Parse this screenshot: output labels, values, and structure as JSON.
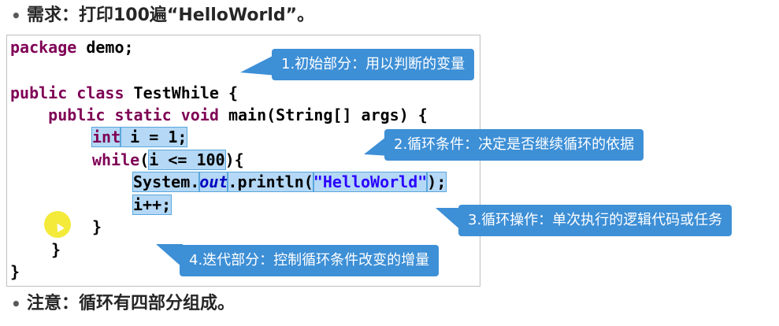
{
  "header": {
    "bullet": "•",
    "requirement_label": "需求：打印100遍“HelloWorld”。"
  },
  "code": {
    "lines": [
      {
        "id": "l1",
        "parts": [
          {
            "t": "package",
            "c": "kw"
          },
          {
            "t": " demo;",
            "c": ""
          }
        ]
      },
      {
        "id": "l2",
        "parts": [
          {
            "t": "public",
            "c": "kw"
          },
          {
            "t": " ",
            "c": ""
          },
          {
            "t": "class",
            "c": "kw"
          },
          {
            "t": " TestWhile {",
            "c": ""
          }
        ]
      },
      {
        "id": "l3",
        "parts": [
          {
            "t": "    public",
            "c": "kw"
          },
          {
            "t": " ",
            "c": ""
          },
          {
            "t": "static",
            "c": "kw"
          },
          {
            "t": " ",
            "c": ""
          },
          {
            "t": "void",
            "c": "kw"
          },
          {
            "t": " main(String[] args) {",
            "c": ""
          }
        ]
      },
      {
        "id": "l4",
        "parts": [
          {
            "t": "int",
            "c": "kw hl"
          },
          {
            "t": " i = 1;",
            "c": "hl"
          }
        ]
      },
      {
        "id": "l5",
        "parts": [
          {
            "t": "while",
            "c": "kw"
          },
          {
            "t": "(",
            "c": ""
          },
          {
            "t": "i <= 100",
            "c": "hl"
          },
          {
            "t": "){",
            "c": ""
          }
        ]
      },
      {
        "id": "l6",
        "parts": [
          {
            "t": "System.",
            "c": "hl"
          },
          {
            "t": "out",
            "c": "fld hl"
          },
          {
            "t": ".println(",
            "c": "hl"
          },
          {
            "t": "\"HelloWorld\"",
            "c": "str hl"
          },
          {
            "t": ");",
            "c": "hl"
          }
        ]
      },
      {
        "id": "l7",
        "parts": [
          {
            "t": "i++;",
            "c": "hl"
          }
        ]
      },
      {
        "id": "l8",
        "parts": [
          {
            "t": "}",
            "c": ""
          }
        ]
      },
      {
        "id": "l9",
        "parts": [
          {
            "t": "}",
            "c": ""
          }
        ]
      },
      {
        "id": "l10",
        "parts": [
          {
            "t": "}",
            "c": ""
          }
        ]
      }
    ]
  },
  "callouts": {
    "init": "1.初始部分：用以判断的变量",
    "condition": "2.循环条件：决定是否继续循环的依据",
    "operation": "3.循环操作：单次执行的逻辑代码或任务",
    "iteration": "4.迭代部分：控制循环条件改变的增量"
  },
  "footer": {
    "bullet": "•",
    "note_label": "注意：循环有四部分组成。"
  },
  "colors": {
    "callout_bg": "#3d8fd6",
    "keyword": "#7f0055",
    "string": "#2a00ff",
    "highlight": "#b4d8f5",
    "cursor_highlight": "#f3ea3a"
  }
}
